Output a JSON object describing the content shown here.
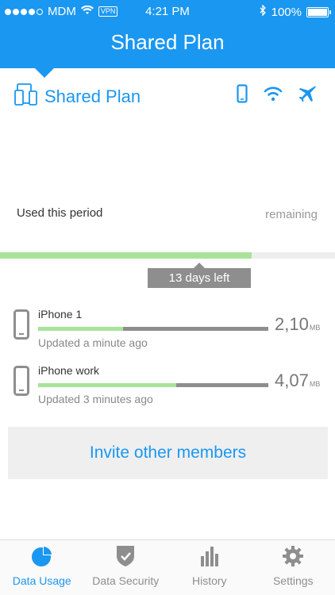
{
  "status_bar": {
    "carrier": "MDM",
    "vpn": "VPN",
    "time": "4:21 PM",
    "battery": "100%"
  },
  "header": {
    "title": "Shared Plan"
  },
  "plan": {
    "name": "Shared Plan"
  },
  "usage": {
    "used_label": "Used this period",
    "remaining_label": "remaining",
    "period_progress": 0.75,
    "days_left": "13 days left"
  },
  "devices": [
    {
      "name": "iPhone 1",
      "updated": "Updated a minute ago",
      "value": "2,10",
      "unit": "MB",
      "usage_fraction": 0.37
    },
    {
      "name": "iPhone work",
      "updated": "Updated 3 minutes ago",
      "value": "4,07",
      "unit": "MB",
      "usage_fraction": 0.6
    }
  ],
  "invite": {
    "label": "Invite other members"
  },
  "tabs": [
    {
      "label": "Data Usage",
      "icon": "pie-chart-icon",
      "active": true
    },
    {
      "label": "Data Security",
      "icon": "shield-icon",
      "active": false
    },
    {
      "label": "History",
      "icon": "bar-chart-icon",
      "active": false
    },
    {
      "label": "Settings",
      "icon": "gear-icon",
      "active": false
    }
  ],
  "colors": {
    "accent": "#1a97f0",
    "progress": "#a8e39a",
    "track": "#8e8e8e"
  }
}
